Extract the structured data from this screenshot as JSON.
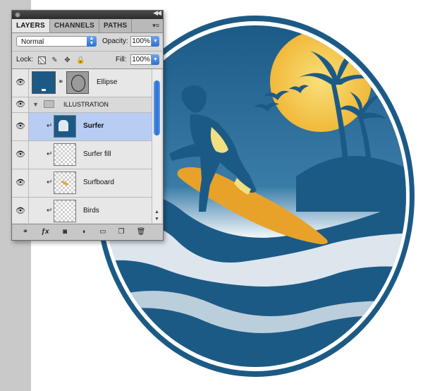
{
  "panel": {
    "tabs": [
      "LAYERS",
      "CHANNELS",
      "PATHS"
    ],
    "blend_mode": "Normal",
    "opacity_label": "Opacity:",
    "opacity_value": "100%",
    "lock_label": "Lock:",
    "fill_label": "Fill:",
    "fill_value": "100%"
  },
  "layers": [
    {
      "name": "Ellipse",
      "kind": "shape"
    },
    {
      "name": "ILLUSTRATION",
      "kind": "group"
    },
    {
      "name": "Surfer",
      "kind": "pixel",
      "selected": true
    },
    {
      "name": "Surfer fill",
      "kind": "pixel"
    },
    {
      "name": "Surfboard",
      "kind": "pixel"
    },
    {
      "name": "Birds",
      "kind": "pixel"
    }
  ],
  "icons": {
    "panel_menu": "menu-icon",
    "eye": "eye-icon",
    "lock_transparent": "lock-transparent-icon",
    "lock_paint": "brush-icon",
    "lock_move": "move-icon",
    "lock_all": "lock-icon",
    "group_folder": "folder-icon",
    "bottom": [
      "link-icon",
      "fx-icon",
      "mask-icon",
      "adjustment-icon",
      "folder-icon",
      "new-layer-icon",
      "trash-icon"
    ]
  },
  "colors": {
    "navy": "#1c5a86",
    "sun": "#f5c24a",
    "board": "#e8a22a",
    "selection": "#b7cdf4"
  }
}
